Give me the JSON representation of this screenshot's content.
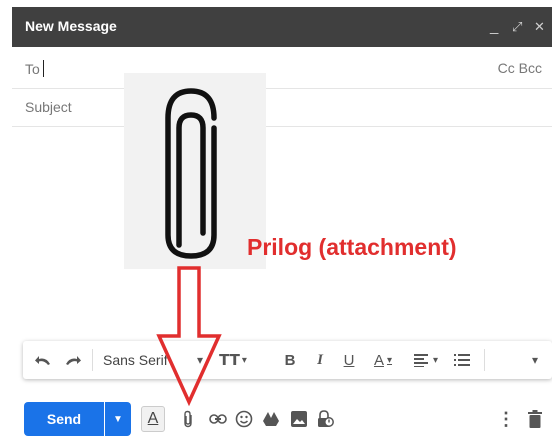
{
  "window": {
    "title": "New Message",
    "minimize": "_",
    "popout": "⤢",
    "close": "✕"
  },
  "fields": {
    "to_label": "To",
    "cc_bcc": "Cc Bcc",
    "subject_label": "Subject"
  },
  "annotation": {
    "text": "Prilog (attachment)",
    "color": "#e12e2e"
  },
  "format_toolbar": {
    "font_name": "Sans Serif",
    "font_caret": "▾"
  },
  "actions": {
    "send_label": "Send",
    "send_color": "#1a73e8",
    "more_glyph": "⋮"
  },
  "icons": [
    "undo-icon",
    "redo-icon",
    "text-size-icon",
    "bold-icon",
    "italic-icon",
    "underline-icon",
    "text-color-icon",
    "align-icon",
    "numbered-list-icon",
    "more-format-icon",
    "formatting-icon",
    "attach-icon",
    "link-icon",
    "emoji-icon",
    "drive-icon",
    "photo-icon",
    "confidential-icon",
    "more-options-icon",
    "trash-icon"
  ]
}
